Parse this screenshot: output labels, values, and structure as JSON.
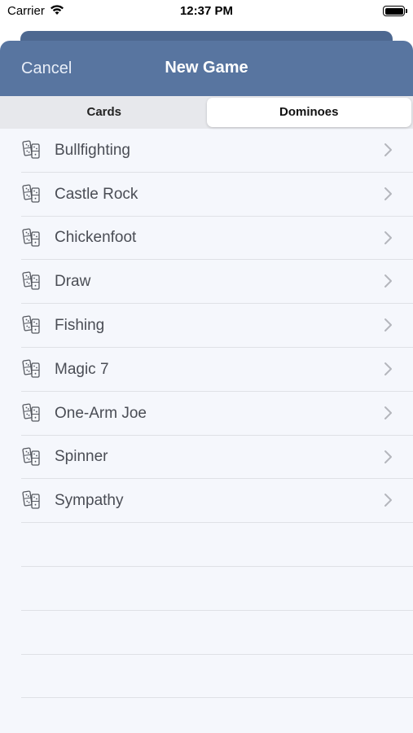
{
  "status_bar": {
    "carrier": "Carrier",
    "time": "12:37 PM"
  },
  "nav": {
    "cancel_label": "Cancel",
    "title": "New Game"
  },
  "segments": [
    {
      "label": "Cards",
      "selected": false
    },
    {
      "label": "Dominoes",
      "selected": true
    }
  ],
  "games": [
    {
      "label": "Bullfighting",
      "icon": "domino-tiles-icon"
    },
    {
      "label": "Castle Rock",
      "icon": "domino-tiles-icon"
    },
    {
      "label": "Chickenfoot",
      "icon": "domino-tiles-icon"
    },
    {
      "label": "Draw",
      "icon": "domino-tiles-icon"
    },
    {
      "label": "Fishing",
      "icon": "domino-tiles-icon"
    },
    {
      "label": "Magic 7",
      "icon": "domino-tiles-icon"
    },
    {
      "label": "One-Arm Joe",
      "icon": "domino-tiles-icon"
    },
    {
      "label": "Spinner",
      "icon": "domino-tiles-icon"
    },
    {
      "label": "Sympathy",
      "icon": "domino-tiles-icon"
    }
  ],
  "colors": {
    "nav_background": "#5875a0",
    "sheet_background": "#f5f7fc",
    "label_text": "#4a4d55",
    "chevron": "#b4b6bc"
  }
}
